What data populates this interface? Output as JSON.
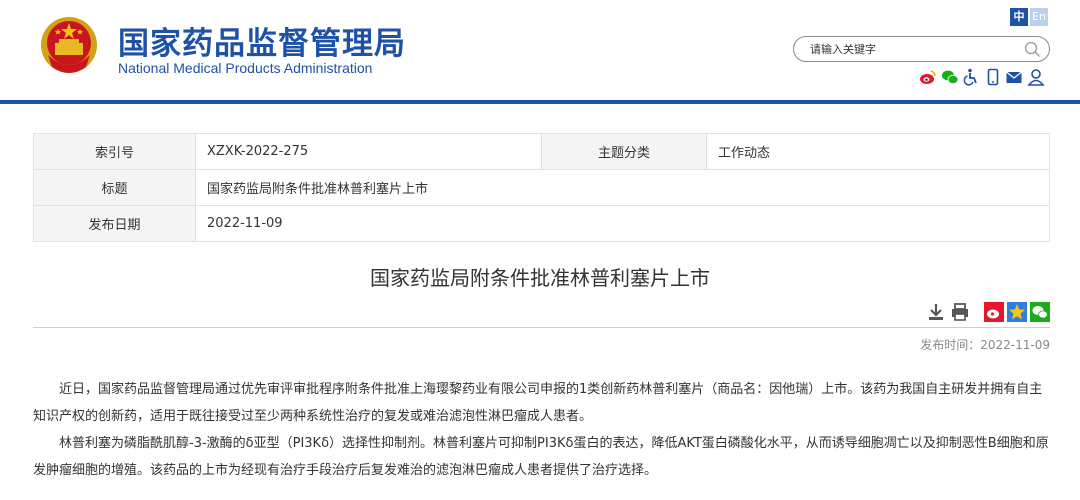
{
  "header": {
    "site_name_cn": "国家药品监督管理局",
    "site_name_en": "National Medical Products Administration",
    "lang_cn": "中",
    "lang_en": "En",
    "search_placeholder": "请输入关键字",
    "social_icons": [
      "weibo-icon",
      "wechat-icon",
      "accessibility-icon",
      "mobile-icon",
      "mail-icon",
      "user-icon"
    ]
  },
  "meta": {
    "index_label": "索引号",
    "index_value": "XZXK-2022-275",
    "category_label": "主题分类",
    "category_value": "工作动态",
    "title_label": "标题",
    "title_value": "国家药监局附条件批准林普利塞片上市",
    "date_label": "发布日期",
    "date_value": "2022-11-09"
  },
  "article": {
    "title": "国家药监局附条件批准林普利塞片上市",
    "pub_label": "发布时间：",
    "pub_date": "2022-11-09",
    "paragraphs": [
      "近日，国家药品监督管理局通过优先审评审批程序附条件批准上海璎黎药业有限公司申报的1类创新药林普利塞片（商品名：因他瑞）上市。该药为我国自主研发并拥有自主知识产权的创新药，适用于既往接受过至少两种系统性治疗的复发或难治滤泡性淋巴瘤成人患者。",
      "林普利塞为磷脂酰肌醇-3-激酶的δ亚型（PI3Kδ）选择性抑制剂。林普利塞片可抑制PI3Kδ蛋白的表达，降低AKT蛋白磷酸化水平，从而诱导细胞凋亡以及抑制恶性B细胞和原发肿瘤细胞的增殖。该药品的上市为经现有治疗手段治疗后复发难治的滤泡淋巴瘤成人患者提供了治疗选择。"
    ]
  },
  "colors": {
    "brand_blue": "#1d52a8"
  }
}
